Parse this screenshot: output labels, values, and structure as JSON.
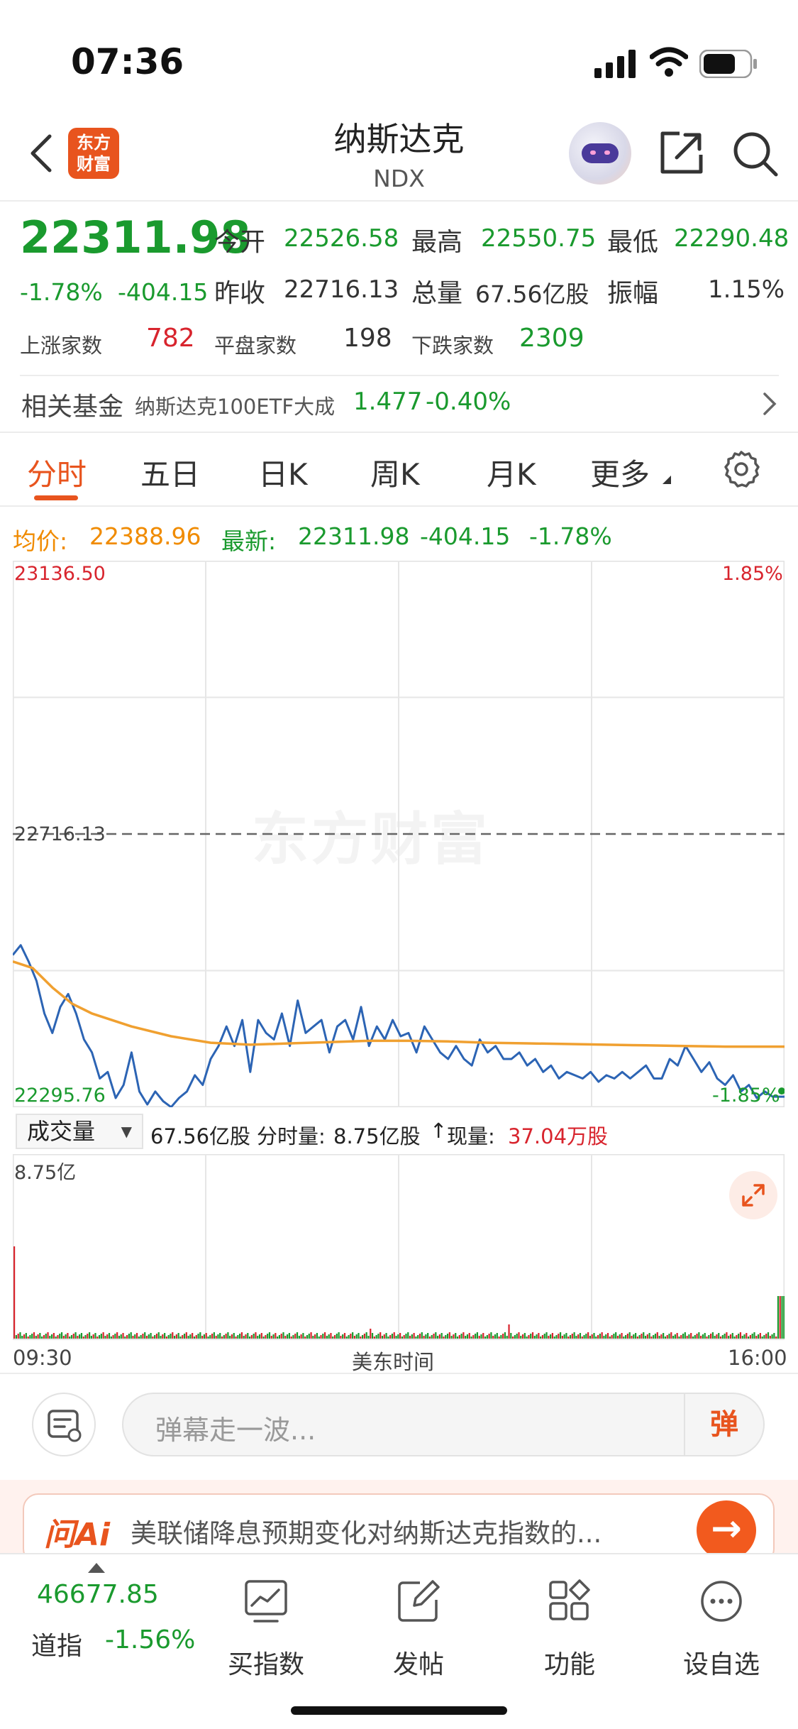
{
  "status_bar": {
    "time": "07:36"
  },
  "header": {
    "title": "纳斯达克",
    "code": "NDX",
    "logo_text": "东方财富"
  },
  "quote": {
    "price": "22311.98",
    "change_pct": "-1.78%",
    "change": "-404.15",
    "open_label": "今开",
    "open": "22526.58",
    "high_label": "最高",
    "high": "22550.75",
    "low_label": "最低",
    "low": "22290.48",
    "prev_close_label": "昨收",
    "prev_close": "22716.13",
    "volume_label": "总量",
    "volume": "67.56亿股",
    "amplitude_label": "振幅",
    "amplitude": "1.15%",
    "up_label": "上涨家数",
    "up_count": "782",
    "flat_label": "平盘家数",
    "flat_count": "198",
    "down_label": "下跌家数",
    "down_count": "2309"
  },
  "related_fund": {
    "label": "相关基金",
    "name": "纳斯达克100ETF大成",
    "price": "1.477",
    "change_pct": "-0.40%"
  },
  "tabs": [
    {
      "label": "分时",
      "active": true
    },
    {
      "label": "五日",
      "active": false
    },
    {
      "label": "日K",
      "active": false
    },
    {
      "label": "周K",
      "active": false
    },
    {
      "label": "月K",
      "active": false
    },
    {
      "label": "更多",
      "active": false
    }
  ],
  "summary": {
    "avg_label": "均价:",
    "avg_value": "22388.96",
    "latest_label": "最新:",
    "latest_value": "22311.98",
    "latest_change": "-404.15",
    "latest_pct": "-1.78%"
  },
  "colors": {
    "up": "#d8242d",
    "down": "#1a9a2e",
    "accent": "#e8541e",
    "price_line": "#2c64b4",
    "avg_line": "#f0a030"
  },
  "chart_data": {
    "type": "line",
    "y_top_label": "23136.50",
    "y_mid_label": "22716.13",
    "y_bottom_label": "22295.76",
    "pct_top_label": "1.85%",
    "pct_bottom_label": "-1.85%",
    "ylim": [
      22295.76,
      23136.5
    ],
    "prev_close": 22716.13,
    "x_start_label": "09:30",
    "x_mid_label": "美东时间",
    "x_end_label": "16:00",
    "watermark": "东方财富",
    "grid": true,
    "series": [
      {
        "x": [
          0,
          4,
          8,
          12,
          16,
          20,
          24,
          28,
          32,
          36,
          40,
          44,
          48,
          52,
          56,
          60,
          64,
          68,
          72,
          76,
          80,
          84,
          88,
          92,
          96,
          100,
          104,
          108,
          112,
          116,
          120,
          124,
          128,
          132,
          136,
          140,
          144,
          148,
          152,
          156,
          160,
          164,
          168,
          172,
          176,
          180,
          184,
          188,
          192,
          196,
          200,
          204,
          208,
          212,
          216,
          220,
          224,
          228,
          232,
          236,
          240,
          244,
          248,
          252,
          256,
          260,
          264,
          268,
          272,
          276,
          280,
          284,
          288,
          292,
          296,
          300,
          304,
          308,
          312,
          316,
          320,
          324,
          328,
          332,
          336,
          340,
          344,
          348,
          352,
          356,
          360,
          364,
          368,
          372,
          376,
          380,
          384,
          388,
          390
        ],
        "values": [
          22530,
          22545,
          22520,
          22490,
          22440,
          22410,
          22450,
          22470,
          22440,
          22400,
          22380,
          22340,
          22350,
          22310,
          22330,
          22380,
          22320,
          22300,
          22320,
          22305,
          22296,
          22310,
          22320,
          22345,
          22330,
          22370,
          22390,
          22420,
          22390,
          22430,
          22350,
          22430,
          22410,
          22400,
          22440,
          22390,
          22460,
          22410,
          22420,
          22430,
          22380,
          22420,
          22430,
          22400,
          22450,
          22390,
          22420,
          22400,
          22430,
          22405,
          22410,
          22380,
          22420,
          22400,
          22380,
          22370,
          22390,
          22370,
          22360,
          22400,
          22380,
          22390,
          22370,
          22370,
          22380,
          22360,
          22370,
          22350,
          22360,
          22340,
          22350,
          22345,
          22340,
          22350,
          22335,
          22345,
          22340,
          22350,
          22340,
          22350,
          22360,
          22340,
          22340,
          22370,
          22360,
          22390,
          22370,
          22350,
          22365,
          22340,
          22330,
          22345,
          22320,
          22330,
          22310,
          22320,
          22312,
          22311.98,
          22311.98
        ]
      },
      {
        "x": [
          0,
          10,
          20,
          30,
          40,
          60,
          80,
          100,
          120,
          140,
          160,
          180,
          200,
          220,
          240,
          260,
          280,
          300,
          320,
          340,
          360,
          380,
          390
        ],
        "values": [
          22520,
          22510,
          22480,
          22455,
          22440,
          22420,
          22405,
          22395,
          22392,
          22394,
          22396,
          22398,
          22398,
          22397,
          22395,
          22394,
          22393,
          22392,
          22391,
          22390,
          22389,
          22389,
          22388.96
        ]
      }
    ]
  },
  "volume": {
    "selector_label": "成交量",
    "total": "67.56亿股",
    "interval_label": "分时量:",
    "interval_value": "8.75亿股",
    "current_label": "现量:",
    "current_value": "37.04万股",
    "axis_max_label": "8.75亿"
  },
  "barrage": {
    "placeholder": "弹幕走一波...",
    "send_label": "弹"
  },
  "ai_banner": {
    "brand": "问Ai",
    "text": "美联储降息预期变化对纳斯达克指数的..."
  },
  "bottom_nav": {
    "index_value": "46677.85",
    "index_name": "道指",
    "index_pct": "-1.56%",
    "items": [
      {
        "label": "买指数"
      },
      {
        "label": "发帖"
      },
      {
        "label": "功能"
      },
      {
        "label": "设自选"
      }
    ]
  }
}
